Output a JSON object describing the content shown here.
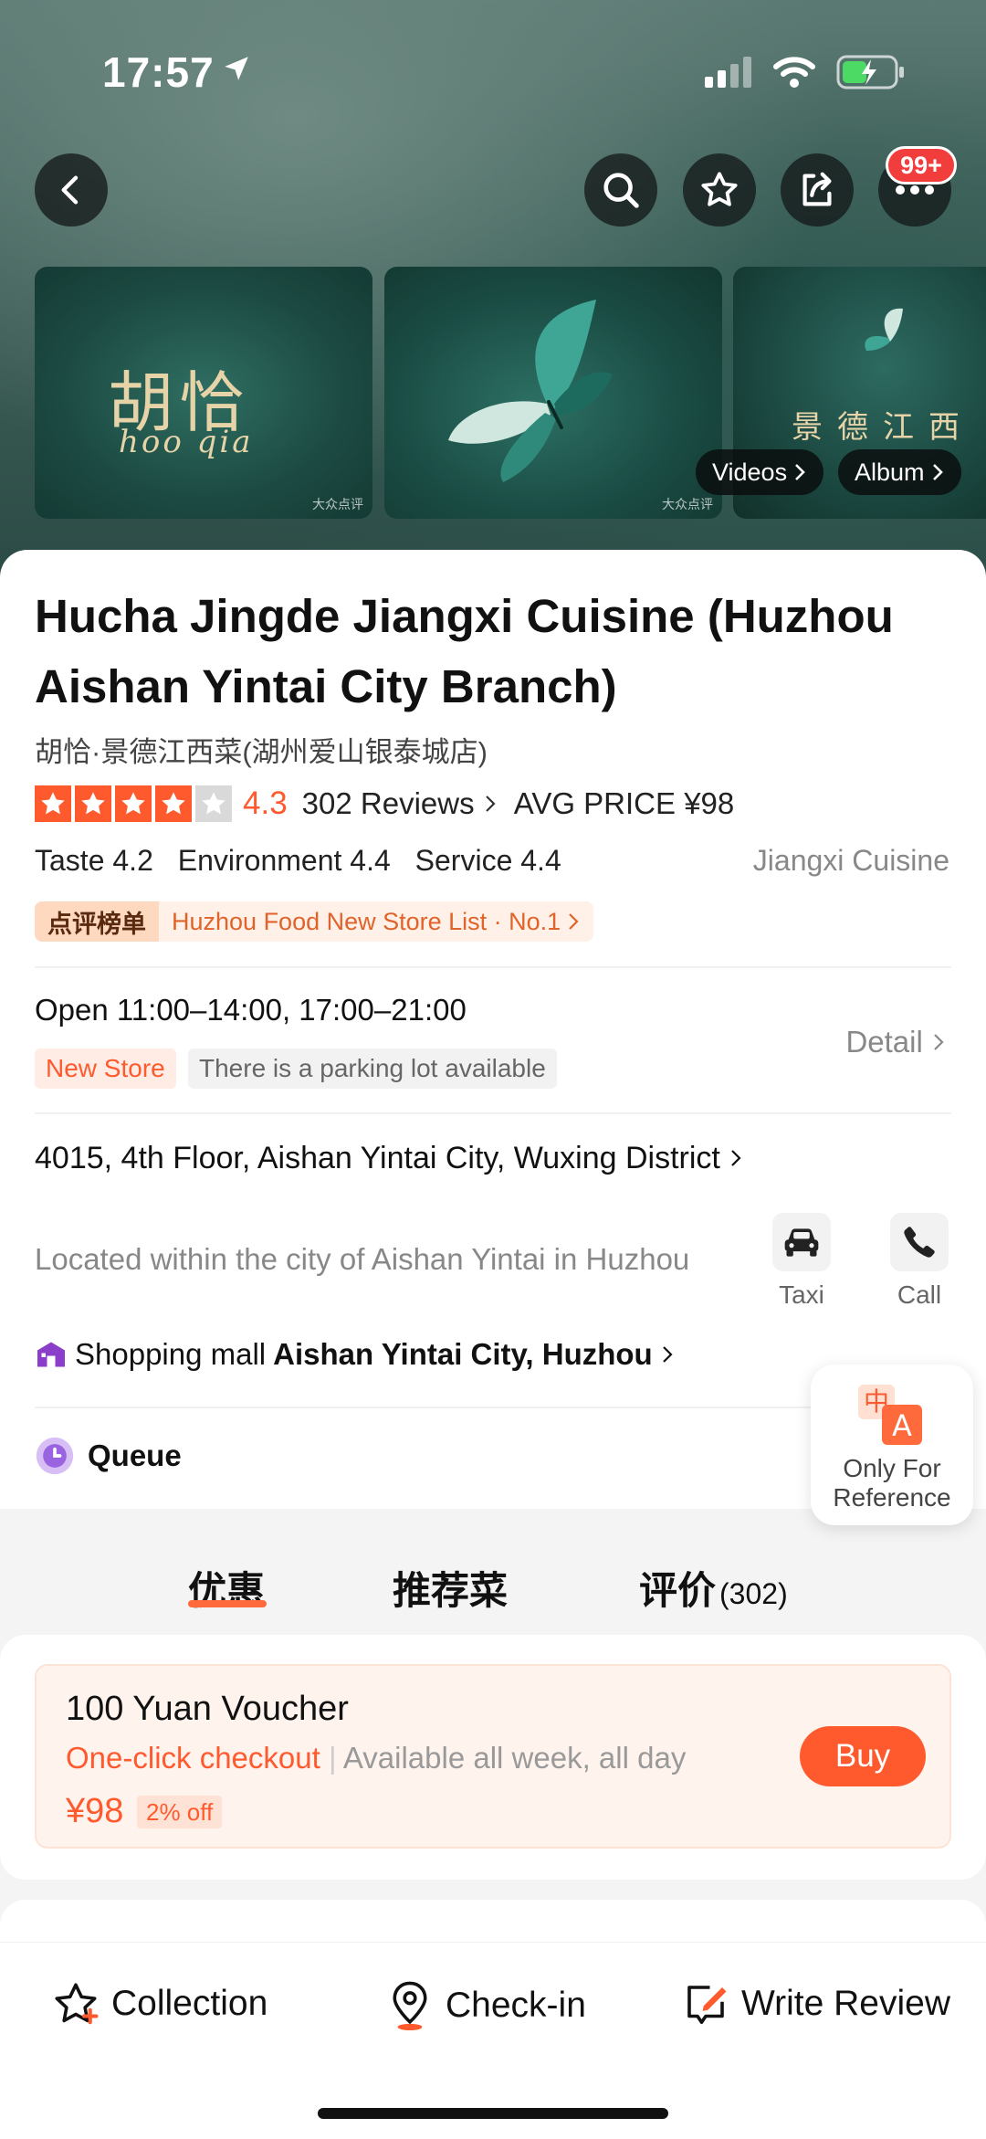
{
  "status_bar": {
    "time": "17:57"
  },
  "header": {
    "notification_badge": "99+"
  },
  "gallery": {
    "thumb1_logo": "胡恰",
    "thumb1_logo_sub": "hoo qia",
    "thumb3_text": "景德江西",
    "watermark": "大众点评",
    "videos_label": "Videos",
    "album_label": "Album"
  },
  "restaurant": {
    "name": "Hucha Jingde Jiangxi Cuisine (Huzhou Aishan Yintai City Branch)",
    "name_cn": "胡恰·景德江西菜(湖州爱山银泰城店)",
    "stars": 4.3,
    "score": "4.3",
    "reviews": "302 Reviews",
    "avg_price": "AVG PRICE ¥98",
    "taste": "Taste 4.2",
    "environment": "Environment 4.4",
    "service": "Service 4.4",
    "cuisine": "Jiangxi Cuisine",
    "rank_tag": "点评榜单",
    "rank_text": "Huzhou Food New Store List · No.1",
    "hours": "Open  11:00–14:00, 17:00–21:00",
    "chip_new": "New Store",
    "chip_parking": "There is a parking lot available",
    "detail": "Detail",
    "address": "4015, 4th Floor, Aishan Yintai City, Wuxing District",
    "located": "Located within the city of Aishan Yintai in Huzhou",
    "mall_prefix": "Shopping mall",
    "mall_name": "Aishan Yintai City, Huzhou",
    "taxi": "Taxi",
    "call": "Call",
    "queue": "Queue"
  },
  "translate": {
    "label": "Only For Reference",
    "icon_zh": "中",
    "icon_en": "A"
  },
  "tabs": [
    {
      "label": "优惠",
      "count": ""
    },
    {
      "label": "推荐菜",
      "count": ""
    },
    {
      "label": "评价",
      "count": "(302)"
    }
  ],
  "voucher": {
    "title": "100 Yuan Voucher",
    "checkout": "One-click checkout",
    "availability": "Available all week, all day",
    "price": "¥98",
    "discount": "2% off",
    "buy": "Buy"
  },
  "bottom_bar": {
    "collection": "Collection",
    "checkin": "Check-in",
    "review": "Write Review"
  },
  "colors": {
    "accent": "#ff5a2e",
    "badge": "#f23d3d"
  }
}
